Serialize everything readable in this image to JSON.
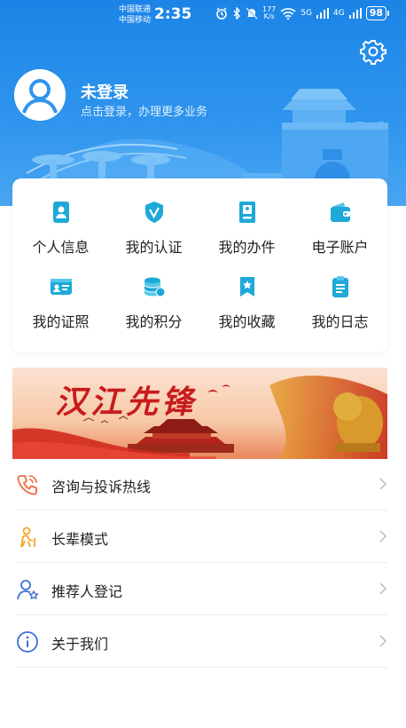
{
  "status_bar": {
    "carrier_1": "中国联通",
    "carrier_2": "中国移动",
    "time": "2:35",
    "speed_value": "177",
    "speed_unit": "K/s",
    "network_1": "5G",
    "network_2": "4G",
    "battery": "98"
  },
  "profile": {
    "title": "未登录",
    "subtitle": "点击登录，办理更多业务"
  },
  "grid": [
    {
      "label": "个人信息",
      "icon": "person-card-icon"
    },
    {
      "label": "我的认证",
      "icon": "shield-check-icon"
    },
    {
      "label": "我的办件",
      "icon": "document-person-icon"
    },
    {
      "label": "电子账户",
      "icon": "wallet-icon"
    },
    {
      "label": "我的证照",
      "icon": "id-card-icon"
    },
    {
      "label": "我的积分",
      "icon": "coins-icon"
    },
    {
      "label": "我的收藏",
      "icon": "bookmark-star-icon"
    },
    {
      "label": "我的日志",
      "icon": "clipboard-icon"
    }
  ],
  "banner": {
    "title": "汉江先锋"
  },
  "menu": [
    {
      "label": "咨询与投诉热线",
      "icon": "phone-icon"
    },
    {
      "label": "长辈模式",
      "icon": "elder-icon"
    },
    {
      "label": "推荐人登记",
      "icon": "user-star-icon"
    },
    {
      "label": "关于我们",
      "icon": "info-icon"
    }
  ],
  "colors": {
    "header_blue": "#1b84e6",
    "icon_teal": "#1ea9d8",
    "banner_red": "#c81b1b",
    "menu_icon_orange": "#f06a3c",
    "menu_icon_yellow": "#f5a623",
    "menu_icon_blue": "#3c6fd8"
  }
}
